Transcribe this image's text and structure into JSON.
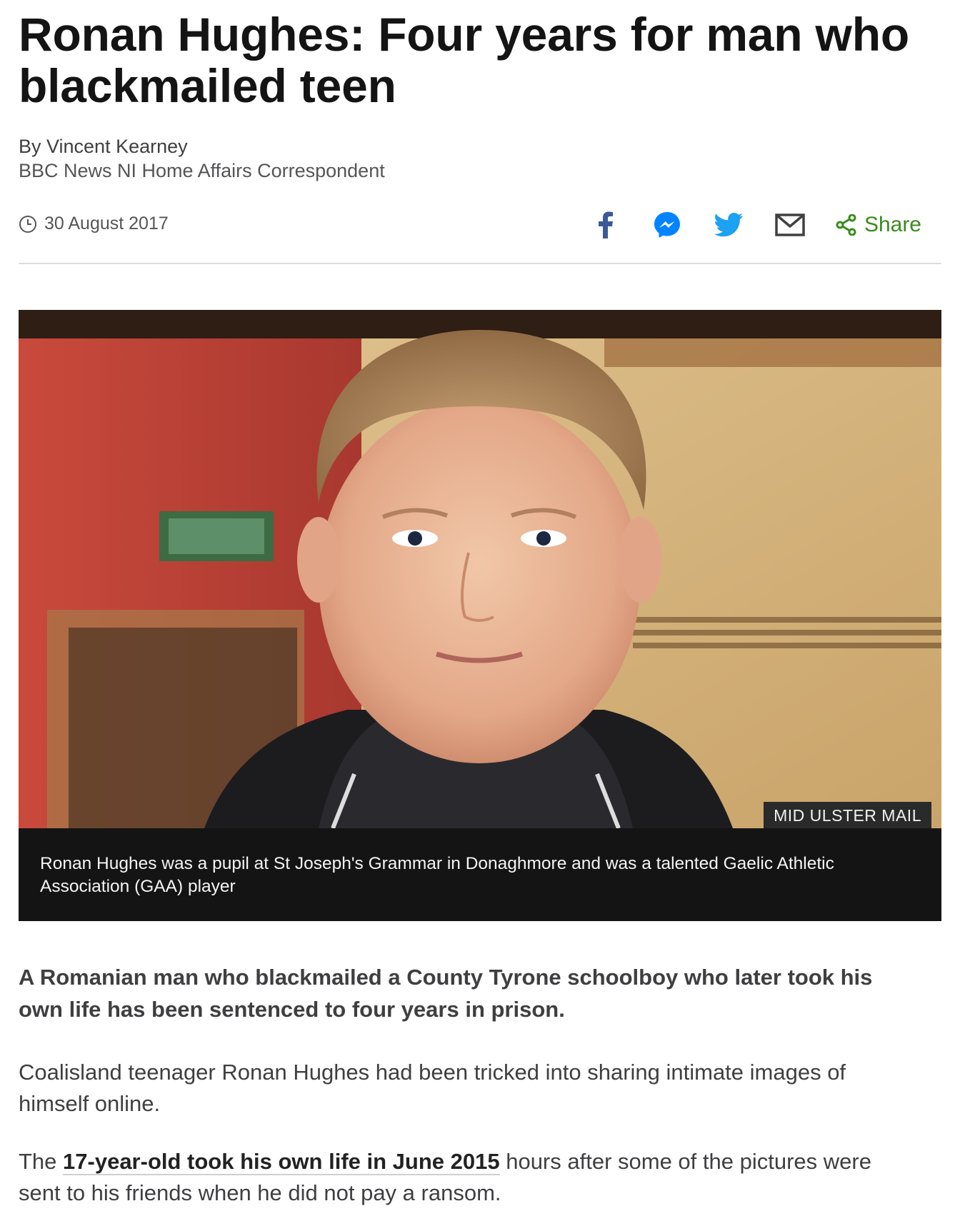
{
  "article": {
    "headline": "Ronan Hughes: Four years for man who blackmailed teen",
    "byline_name": "By Vincent Kearney",
    "byline_role": "BBC News NI Home Affairs Correspondent",
    "date": "30 August 2017"
  },
  "share": {
    "icons": [
      "facebook-icon",
      "messenger-icon",
      "twitter-icon",
      "email-icon",
      "share-icon"
    ],
    "label": "Share",
    "colors": {
      "facebook": "#3b5998",
      "messenger": "#0084ff",
      "twitter": "#1da1f2",
      "email": "#404040",
      "share": "#3a8a1f"
    }
  },
  "figure": {
    "credit": "MID ULSTER MAIL",
    "caption": "Ronan Hughes was a pupil at St Joseph's Grammar in Donaghmore and was a talented Gaelic Athletic Association (GAA) player"
  },
  "body": {
    "intro": "A Romanian man who blackmailed a County Tyrone schoolboy who later took his own life has been sentenced to four years in prison.",
    "para1": "Coalisland teenager Ronan Hughes had been tricked into sharing intimate images of himself online.",
    "para2_before": "The ",
    "para2_link": "17-year-old took his own life in June 2015",
    "para2_after": " hours after some of the pictures were sent to his friends when he did not pay a ransom."
  }
}
